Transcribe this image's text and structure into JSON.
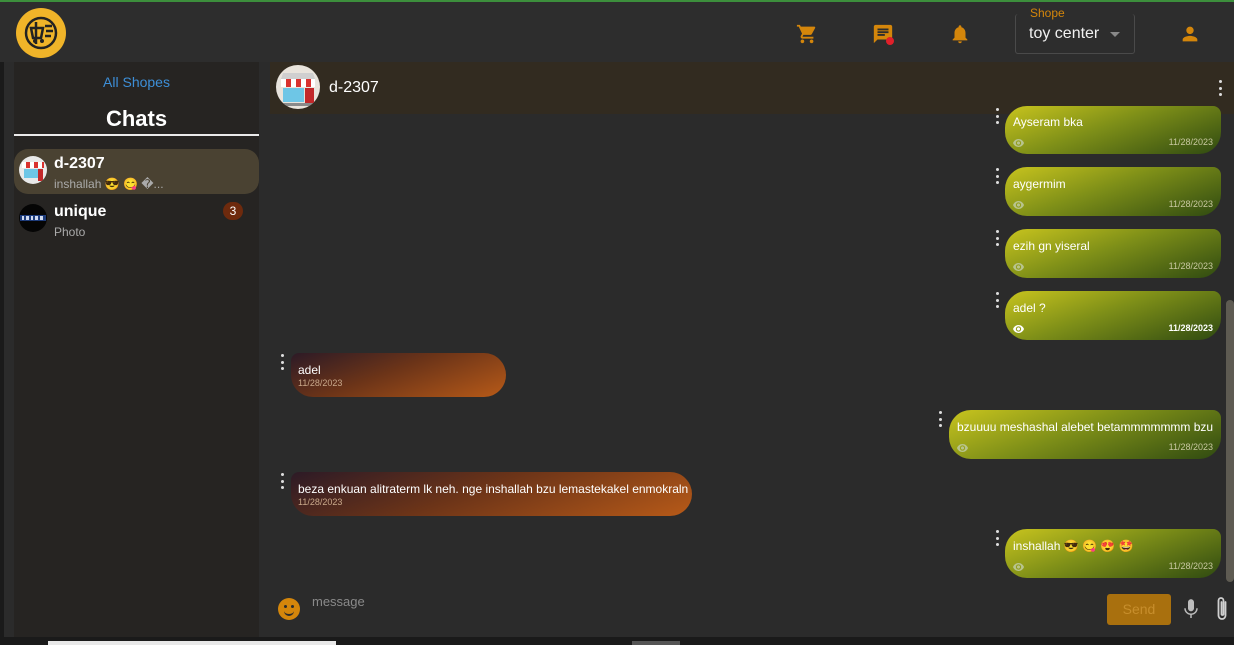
{
  "header": {
    "shop_select": {
      "legend": "Shope",
      "value": "toy center"
    },
    "icons": [
      "cart-icon",
      "message-icon",
      "bell-icon",
      "user-icon"
    ]
  },
  "sidebar": {
    "all_shopes_link": "All Shopes",
    "title": "Chats",
    "chats": [
      {
        "name": "d-2307",
        "preview": "inshallah 😎 😋 �...",
        "unread": null,
        "active": true
      },
      {
        "name": "unique",
        "preview": "Photo",
        "unread": "3",
        "active": false
      }
    ]
  },
  "conversation": {
    "name": "d-2307",
    "messages": [
      {
        "direction": "out",
        "text": "Ayseram bka",
        "time": "11/28/2023",
        "seen": false
      },
      {
        "direction": "out",
        "text": "aygermim",
        "time": "11/28/2023",
        "seen": false
      },
      {
        "direction": "out",
        "text": "ezih gn yiseral",
        "time": "11/28/2023",
        "seen": false
      },
      {
        "direction": "out",
        "text": "adel ?",
        "time": "11/28/2023",
        "seen": true
      },
      {
        "direction": "in",
        "text": "adel",
        "time": "11/28/2023"
      },
      {
        "direction": "out",
        "text": "bzuuuu meshashal alebet betammmmmmm bzu",
        "time": "11/28/2023",
        "seen": false
      },
      {
        "direction": "in",
        "text": "beza enkuan alitraterm lk neh. nge inshallah bzu lemastekakel enmokraln",
        "time": "11/28/2023"
      },
      {
        "direction": "out",
        "text": "inshallah 😎 😋 😍 🤩",
        "time": "11/28/2023",
        "seen": false
      }
    ]
  },
  "composer": {
    "placeholder": "message",
    "send_label": "Send"
  },
  "colors": {
    "accent": "#d4860b",
    "link": "#3d8fd8",
    "notification_dot": "#e0202a",
    "unread_badge": "#6e2a0d"
  }
}
